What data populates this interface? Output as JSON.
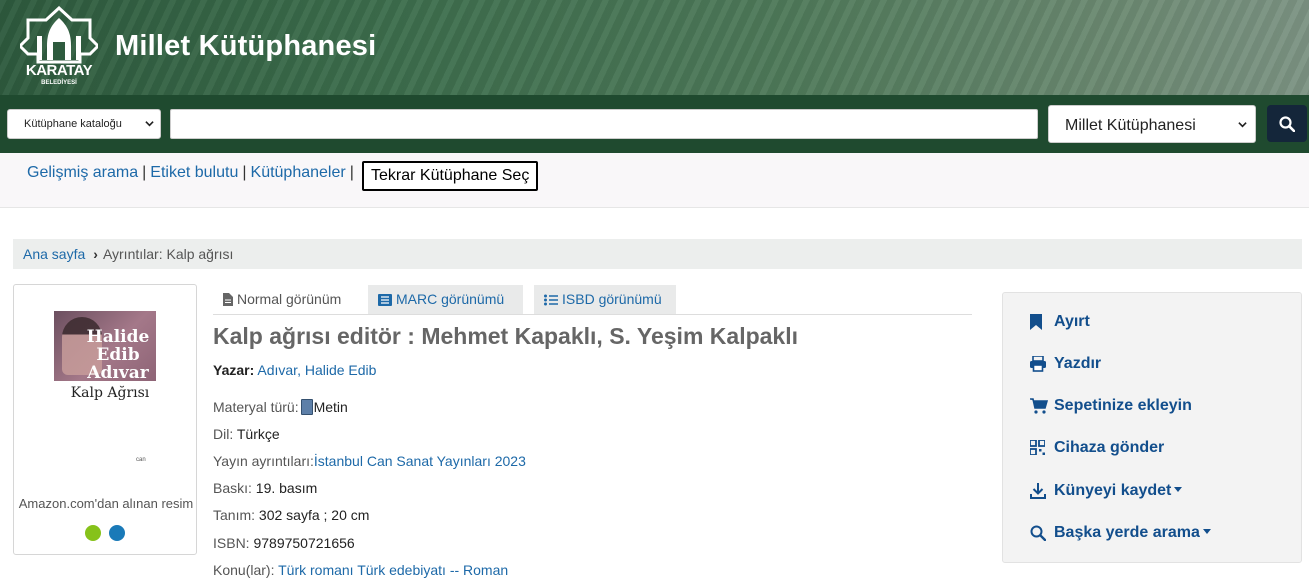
{
  "header": {
    "logo_text": "KARATAY",
    "logo_subtext": "BELEDİYESİ",
    "site_title": "Millet Kütüphanesi"
  },
  "search": {
    "catalog_select": "Kütüphane kataloğu",
    "query_value": "",
    "library_select": "Millet Kütüphanesi"
  },
  "subnav": {
    "advanced_search": "Gelişmiş arama",
    "tag_cloud": "Etiket bulutu",
    "libraries": "Kütüphaneler",
    "separator": "|",
    "reselect_library": "Tekrar Kütüphane Seç"
  },
  "breadcrumb": {
    "home": "Ana sayfa",
    "current": "Ayrıntılar: Kalp ağrısı"
  },
  "cover": {
    "book_author": "Halide Edib Adıvar",
    "book_title": "Kalp Ağrısı",
    "book_publisher": "can",
    "caption": "Amazon.com'dan alınan resim"
  },
  "tabs": {
    "normal": "Normal görünüm",
    "marc": "MARC görünümü",
    "isbd": "ISBD görünümü"
  },
  "record": {
    "title": "Kalp ağrısı editör : Mehmet Kapaklı, S. Yeşim Kalpaklı",
    "author_label": "Yazar:",
    "author_value": "Adıvar, Halide Edib",
    "material_label": "Materyal türü:",
    "material_value": "Metin",
    "language_label": "Dil:",
    "language_value": "Türkçe",
    "publication_label": "Yayın ayrıntıları:",
    "publication_value": "İstanbul Can Sanat Yayınları 2023",
    "edition_label": "Baskı:",
    "edition_value": "19. basım",
    "description_label": "Tanım:",
    "description_value": "302 sayfa ; 20 cm",
    "isbn_label": "ISBN:",
    "isbn_value": "9789750721656",
    "subjects_label": "Konu(lar):",
    "subject_1": "Türk romanı",
    "subject_2": "Türk edebiyatı -- Roman"
  },
  "actions": {
    "hold": "Ayırt",
    "print": "Yazdır",
    "add_to_cart": "Sepetinize ekleyin",
    "send_to_device": "Cihaza gönder",
    "save_record": "Künyeyi kaydet",
    "search_elsewhere": "Başka yerde arama"
  },
  "colors": {
    "header_green": "#2e5b3e",
    "searchbar_green": "#1f4a2f",
    "link_blue": "#1d69a8",
    "action_blue": "#124e8c",
    "search_button": "#14263a"
  }
}
